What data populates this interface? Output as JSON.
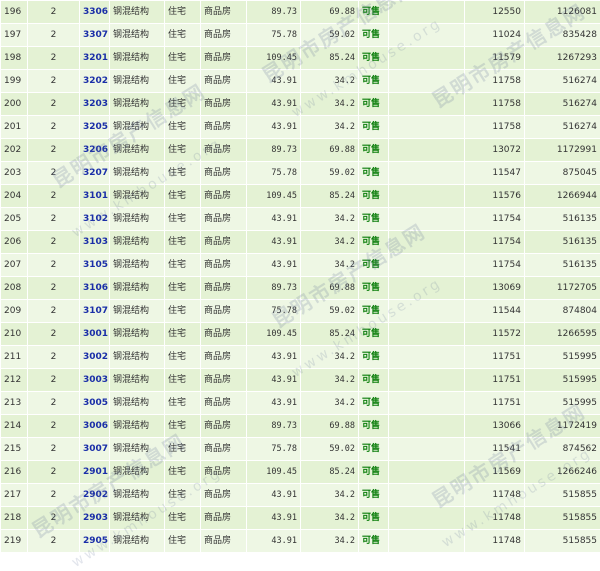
{
  "listing": {
    "rows": [
      {
        "no": "196",
        "floor": "2",
        "room": "3306",
        "structure": "钢混结构",
        "use": "住宅",
        "type": "商品房",
        "area": "89.73",
        "inner_area": "69.88",
        "status": "可售",
        "unit_price": "12550",
        "total_price": "1126081"
      },
      {
        "no": "197",
        "floor": "2",
        "room": "3307",
        "structure": "钢混结构",
        "use": "住宅",
        "type": "商品房",
        "area": "75.78",
        "inner_area": "59.02",
        "status": "可售",
        "unit_price": "11024",
        "total_price": "835428"
      },
      {
        "no": "198",
        "floor": "2",
        "room": "3201",
        "structure": "钢混结构",
        "use": "住宅",
        "type": "商品房",
        "area": "109.45",
        "inner_area": "85.24",
        "status": "可售",
        "unit_price": "11579",
        "total_price": "1267293"
      },
      {
        "no": "199",
        "floor": "2",
        "room": "3202",
        "structure": "钢混结构",
        "use": "住宅",
        "type": "商品房",
        "area": "43.91",
        "inner_area": "34.2",
        "status": "可售",
        "unit_price": "11758",
        "total_price": "516274"
      },
      {
        "no": "200",
        "floor": "2",
        "room": "3203",
        "structure": "钢混结构",
        "use": "住宅",
        "type": "商品房",
        "area": "43.91",
        "inner_area": "34.2",
        "status": "可售",
        "unit_price": "11758",
        "total_price": "516274"
      },
      {
        "no": "201",
        "floor": "2",
        "room": "3205",
        "structure": "钢混结构",
        "use": "住宅",
        "type": "商品房",
        "area": "43.91",
        "inner_area": "34.2",
        "status": "可售",
        "unit_price": "11758",
        "total_price": "516274"
      },
      {
        "no": "202",
        "floor": "2",
        "room": "3206",
        "structure": "钢混结构",
        "use": "住宅",
        "type": "商品房",
        "area": "89.73",
        "inner_area": "69.88",
        "status": "可售",
        "unit_price": "13072",
        "total_price": "1172991"
      },
      {
        "no": "203",
        "floor": "2",
        "room": "3207",
        "structure": "钢混结构",
        "use": "住宅",
        "type": "商品房",
        "area": "75.78",
        "inner_area": "59.02",
        "status": "可售",
        "unit_price": "11547",
        "total_price": "875045"
      },
      {
        "no": "204",
        "floor": "2",
        "room": "3101",
        "structure": "钢混结构",
        "use": "住宅",
        "type": "商品房",
        "area": "109.45",
        "inner_area": "85.24",
        "status": "可售",
        "unit_price": "11576",
        "total_price": "1266944"
      },
      {
        "no": "205",
        "floor": "2",
        "room": "3102",
        "structure": "钢混结构",
        "use": "住宅",
        "type": "商品房",
        "area": "43.91",
        "inner_area": "34.2",
        "status": "可售",
        "unit_price": "11754",
        "total_price": "516135"
      },
      {
        "no": "206",
        "floor": "2",
        "room": "3103",
        "structure": "钢混结构",
        "use": "住宅",
        "type": "商品房",
        "area": "43.91",
        "inner_area": "34.2",
        "status": "可售",
        "unit_price": "11754",
        "total_price": "516135"
      },
      {
        "no": "207",
        "floor": "2",
        "room": "3105",
        "structure": "钢混结构",
        "use": "住宅",
        "type": "商品房",
        "area": "43.91",
        "inner_area": "34.2",
        "status": "可售",
        "unit_price": "11754",
        "total_price": "516135"
      },
      {
        "no": "208",
        "floor": "2",
        "room": "3106",
        "structure": "钢混结构",
        "use": "住宅",
        "type": "商品房",
        "area": "89.73",
        "inner_area": "69.88",
        "status": "可售",
        "unit_price": "13069",
        "total_price": "1172705"
      },
      {
        "no": "209",
        "floor": "2",
        "room": "3107",
        "structure": "钢混结构",
        "use": "住宅",
        "type": "商品房",
        "area": "75.78",
        "inner_area": "59.02",
        "status": "可售",
        "unit_price": "11544",
        "total_price": "874804"
      },
      {
        "no": "210",
        "floor": "2",
        "room": "3001",
        "structure": "钢混结构",
        "use": "住宅",
        "type": "商品房",
        "area": "109.45",
        "inner_area": "85.24",
        "status": "可售",
        "unit_price": "11572",
        "total_price": "1266595"
      },
      {
        "no": "211",
        "floor": "2",
        "room": "3002",
        "structure": "钢混结构",
        "use": "住宅",
        "type": "商品房",
        "area": "43.91",
        "inner_area": "34.2",
        "status": "可售",
        "unit_price": "11751",
        "total_price": "515995"
      },
      {
        "no": "212",
        "floor": "2",
        "room": "3003",
        "structure": "钢混结构",
        "use": "住宅",
        "type": "商品房",
        "area": "43.91",
        "inner_area": "34.2",
        "status": "可售",
        "unit_price": "11751",
        "total_price": "515995"
      },
      {
        "no": "213",
        "floor": "2",
        "room": "3005",
        "structure": "钢混结构",
        "use": "住宅",
        "type": "商品房",
        "area": "43.91",
        "inner_area": "34.2",
        "status": "可售",
        "unit_price": "11751",
        "total_price": "515995"
      },
      {
        "no": "214",
        "floor": "2",
        "room": "3006",
        "structure": "钢混结构",
        "use": "住宅",
        "type": "商品房",
        "area": "89.73",
        "inner_area": "69.88",
        "status": "可售",
        "unit_price": "13066",
        "total_price": "1172419"
      },
      {
        "no": "215",
        "floor": "2",
        "room": "3007",
        "structure": "钢混结构",
        "use": "住宅",
        "type": "商品房",
        "area": "75.78",
        "inner_area": "59.02",
        "status": "可售",
        "unit_price": "11541",
        "total_price": "874562"
      },
      {
        "no": "216",
        "floor": "2",
        "room": "2901",
        "structure": "钢混结构",
        "use": "住宅",
        "type": "商品房",
        "area": "109.45",
        "inner_area": "85.24",
        "status": "可售",
        "unit_price": "11569",
        "total_price": "1266246"
      },
      {
        "no": "217",
        "floor": "2",
        "room": "2902",
        "structure": "钢混结构",
        "use": "住宅",
        "type": "商品房",
        "area": "43.91",
        "inner_area": "34.2",
        "status": "可售",
        "unit_price": "11748",
        "total_price": "515855"
      },
      {
        "no": "218",
        "floor": "2",
        "room": "2903",
        "structure": "钢混结构",
        "use": "住宅",
        "type": "商品房",
        "area": "43.91",
        "inner_area": "34.2",
        "status": "可售",
        "unit_price": "11748",
        "total_price": "515855"
      },
      {
        "no": "219",
        "floor": "2",
        "room": "2905",
        "structure": "钢混结构",
        "use": "住宅",
        "type": "商品房",
        "area": "43.91",
        "inner_area": "34.2",
        "status": "可售",
        "unit_price": "11748",
        "total_price": "515855"
      }
    ]
  },
  "watermark": {
    "cn_text": "昆明市房产信息网",
    "site_text": "www.kmhouse.org"
  },
  "colors": {
    "row_odd": "#e4f2d4",
    "row_even": "#eef7e4",
    "room_link": "#1a2ea8",
    "status_available": "#0a7d0a"
  }
}
